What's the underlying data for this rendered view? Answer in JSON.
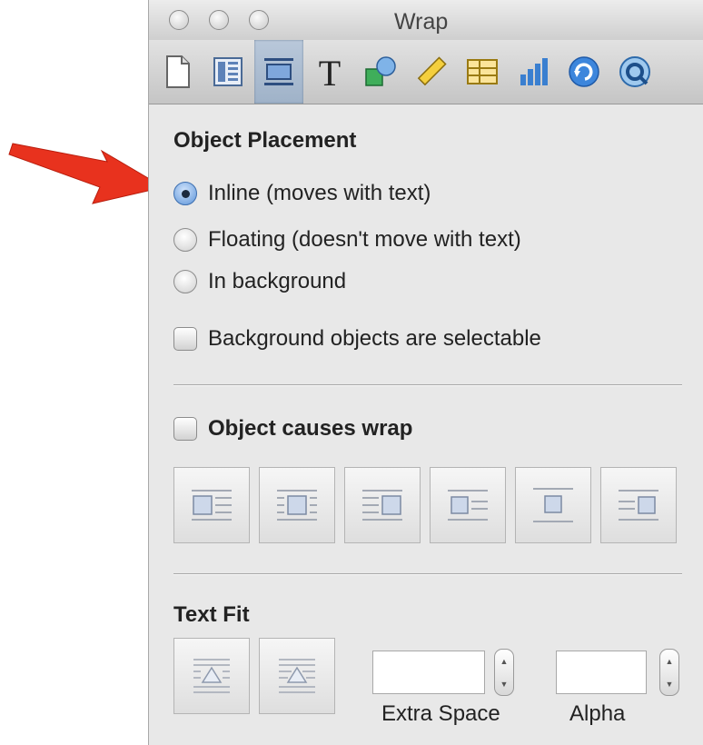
{
  "window": {
    "title": "Wrap"
  },
  "toolbar": {
    "tabs": [
      {
        "icon": "document-icon"
      },
      {
        "icon": "layout-icon"
      },
      {
        "icon": "wrap-icon",
        "active": true
      },
      {
        "icon": "text-icon",
        "glyph": "T"
      },
      {
        "icon": "graphic-icon"
      },
      {
        "icon": "metrics-icon"
      },
      {
        "icon": "table-icon"
      },
      {
        "icon": "chart-icon"
      },
      {
        "icon": "link-icon"
      },
      {
        "icon": "quicktime-icon"
      }
    ]
  },
  "placement": {
    "title": "Object Placement",
    "options": [
      {
        "label": "Inline (moves with text)",
        "selected": true
      },
      {
        "label": "Floating (doesn't move with text)",
        "selected": false
      },
      {
        "label": "In background",
        "selected": false
      }
    ],
    "selectable_label": "Background objects are selectable",
    "selectable_checked": false
  },
  "wrap": {
    "label": "Object causes wrap",
    "checked": false,
    "buttons": [
      "wrap-left",
      "wrap-both",
      "wrap-right",
      "wrap-largest-left",
      "wrap-above-below",
      "wrap-largest-right"
    ]
  },
  "text_fit": {
    "title": "Text Fit",
    "buttons": [
      "fit-rectangle",
      "fit-contour"
    ],
    "extra_space": {
      "label": "Extra Space",
      "value": ""
    },
    "alpha": {
      "label": "Alpha",
      "value": ""
    }
  },
  "colors": {
    "accent_arrow": "#e8321e",
    "selection_blue": "#5d95d9"
  }
}
